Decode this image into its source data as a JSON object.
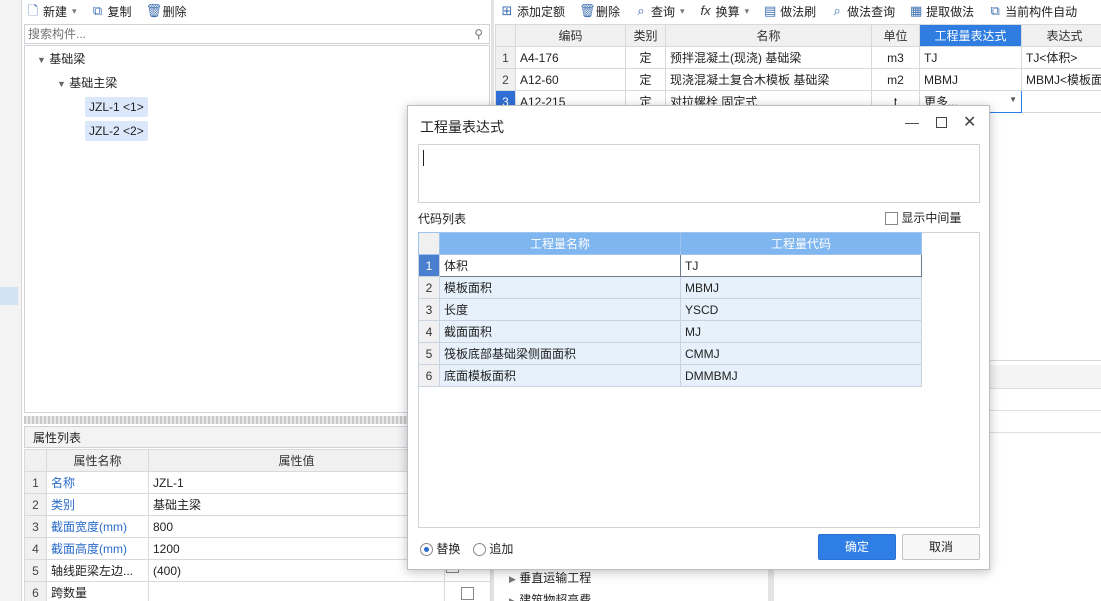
{
  "left_toolbar": {
    "new_label": "新建",
    "copy_label": "复制",
    "delete_label": "删除"
  },
  "left_search": {
    "placeholder": "搜索构件..."
  },
  "tree": {
    "root": "基础梁",
    "child": "基础主梁",
    "items": [
      "JZL-1 <1>",
      "JZL-2 <2>"
    ]
  },
  "props": {
    "title": "属性列表",
    "col_name": "属性名称",
    "col_value": "属性值",
    "rows": [
      {
        "n": "1",
        "name": "名称",
        "value": "JZL-1"
      },
      {
        "n": "2",
        "name": "类别",
        "value": "基础主梁"
      },
      {
        "n": "3",
        "name": "截面宽度(mm)",
        "value": "800"
      },
      {
        "n": "4",
        "name": "截面高度(mm)",
        "value": "1200"
      },
      {
        "n": "5",
        "name": "轴线距梁左边...",
        "value": "(400)"
      },
      {
        "n": "6",
        "name": "跨数量",
        "value": ""
      }
    ]
  },
  "right_toolbar": {
    "add_quota": "添加定额",
    "delete": "删除",
    "query": "查询",
    "convert": "换算",
    "method_brush": "做法刷",
    "method_query": "做法查询",
    "extract_method": "提取做法",
    "current_auto": "当前构件自动"
  },
  "quota_table": {
    "headers": [
      "编码",
      "类别",
      "名称",
      "单位",
      "工程量表达式",
      "表达式"
    ],
    "rows": [
      {
        "n": "1",
        "code": "A4-176",
        "type": "定",
        "name": "预拌混凝土(现浇) 基础梁",
        "unit": "m3",
        "expr": "TJ",
        "expr2": "TJ<体积>"
      },
      {
        "n": "2",
        "code": "A12-60",
        "type": "定",
        "name": "现浇混凝土复合木模板 基础梁",
        "unit": "m2",
        "expr": "MBMJ",
        "expr2": "MBMJ<模板面"
      },
      {
        "n": "3",
        "code": "A12-215",
        "type": "定",
        "name": "对拉螺栓 固定式",
        "unit": "t",
        "expr": "更多...",
        "expr2": ""
      }
    ]
  },
  "lower_tree": {
    "item1": "垂直运输工程",
    "item2": "建筑物超高费"
  },
  "dialog": {
    "title": "工程量表达式",
    "code_list_label": "代码列表",
    "show_intermediate": "显示中间量",
    "col_name": "工程量名称",
    "col_code": "工程量代码",
    "rows": [
      {
        "n": "1",
        "name": "体积",
        "code": "TJ"
      },
      {
        "n": "2",
        "name": "模板面积",
        "code": "MBMJ"
      },
      {
        "n": "3",
        "name": "长度",
        "code": "YSCD"
      },
      {
        "n": "4",
        "name": "截面面积",
        "code": "MJ"
      },
      {
        "n": "5",
        "name": "筏板底部基础梁侧面面积",
        "code": "CMMJ"
      },
      {
        "n": "6",
        "name": "底面模板面积",
        "code": "DMMBMJ"
      }
    ],
    "replace_label": "替换",
    "append_label": "追加",
    "ok_label": "确定",
    "cancel_label": "取消"
  },
  "colors": {
    "accent": "#2e7ee6",
    "header_blue": "#7fb6ef",
    "cell_blue": "#e6f1fb"
  }
}
